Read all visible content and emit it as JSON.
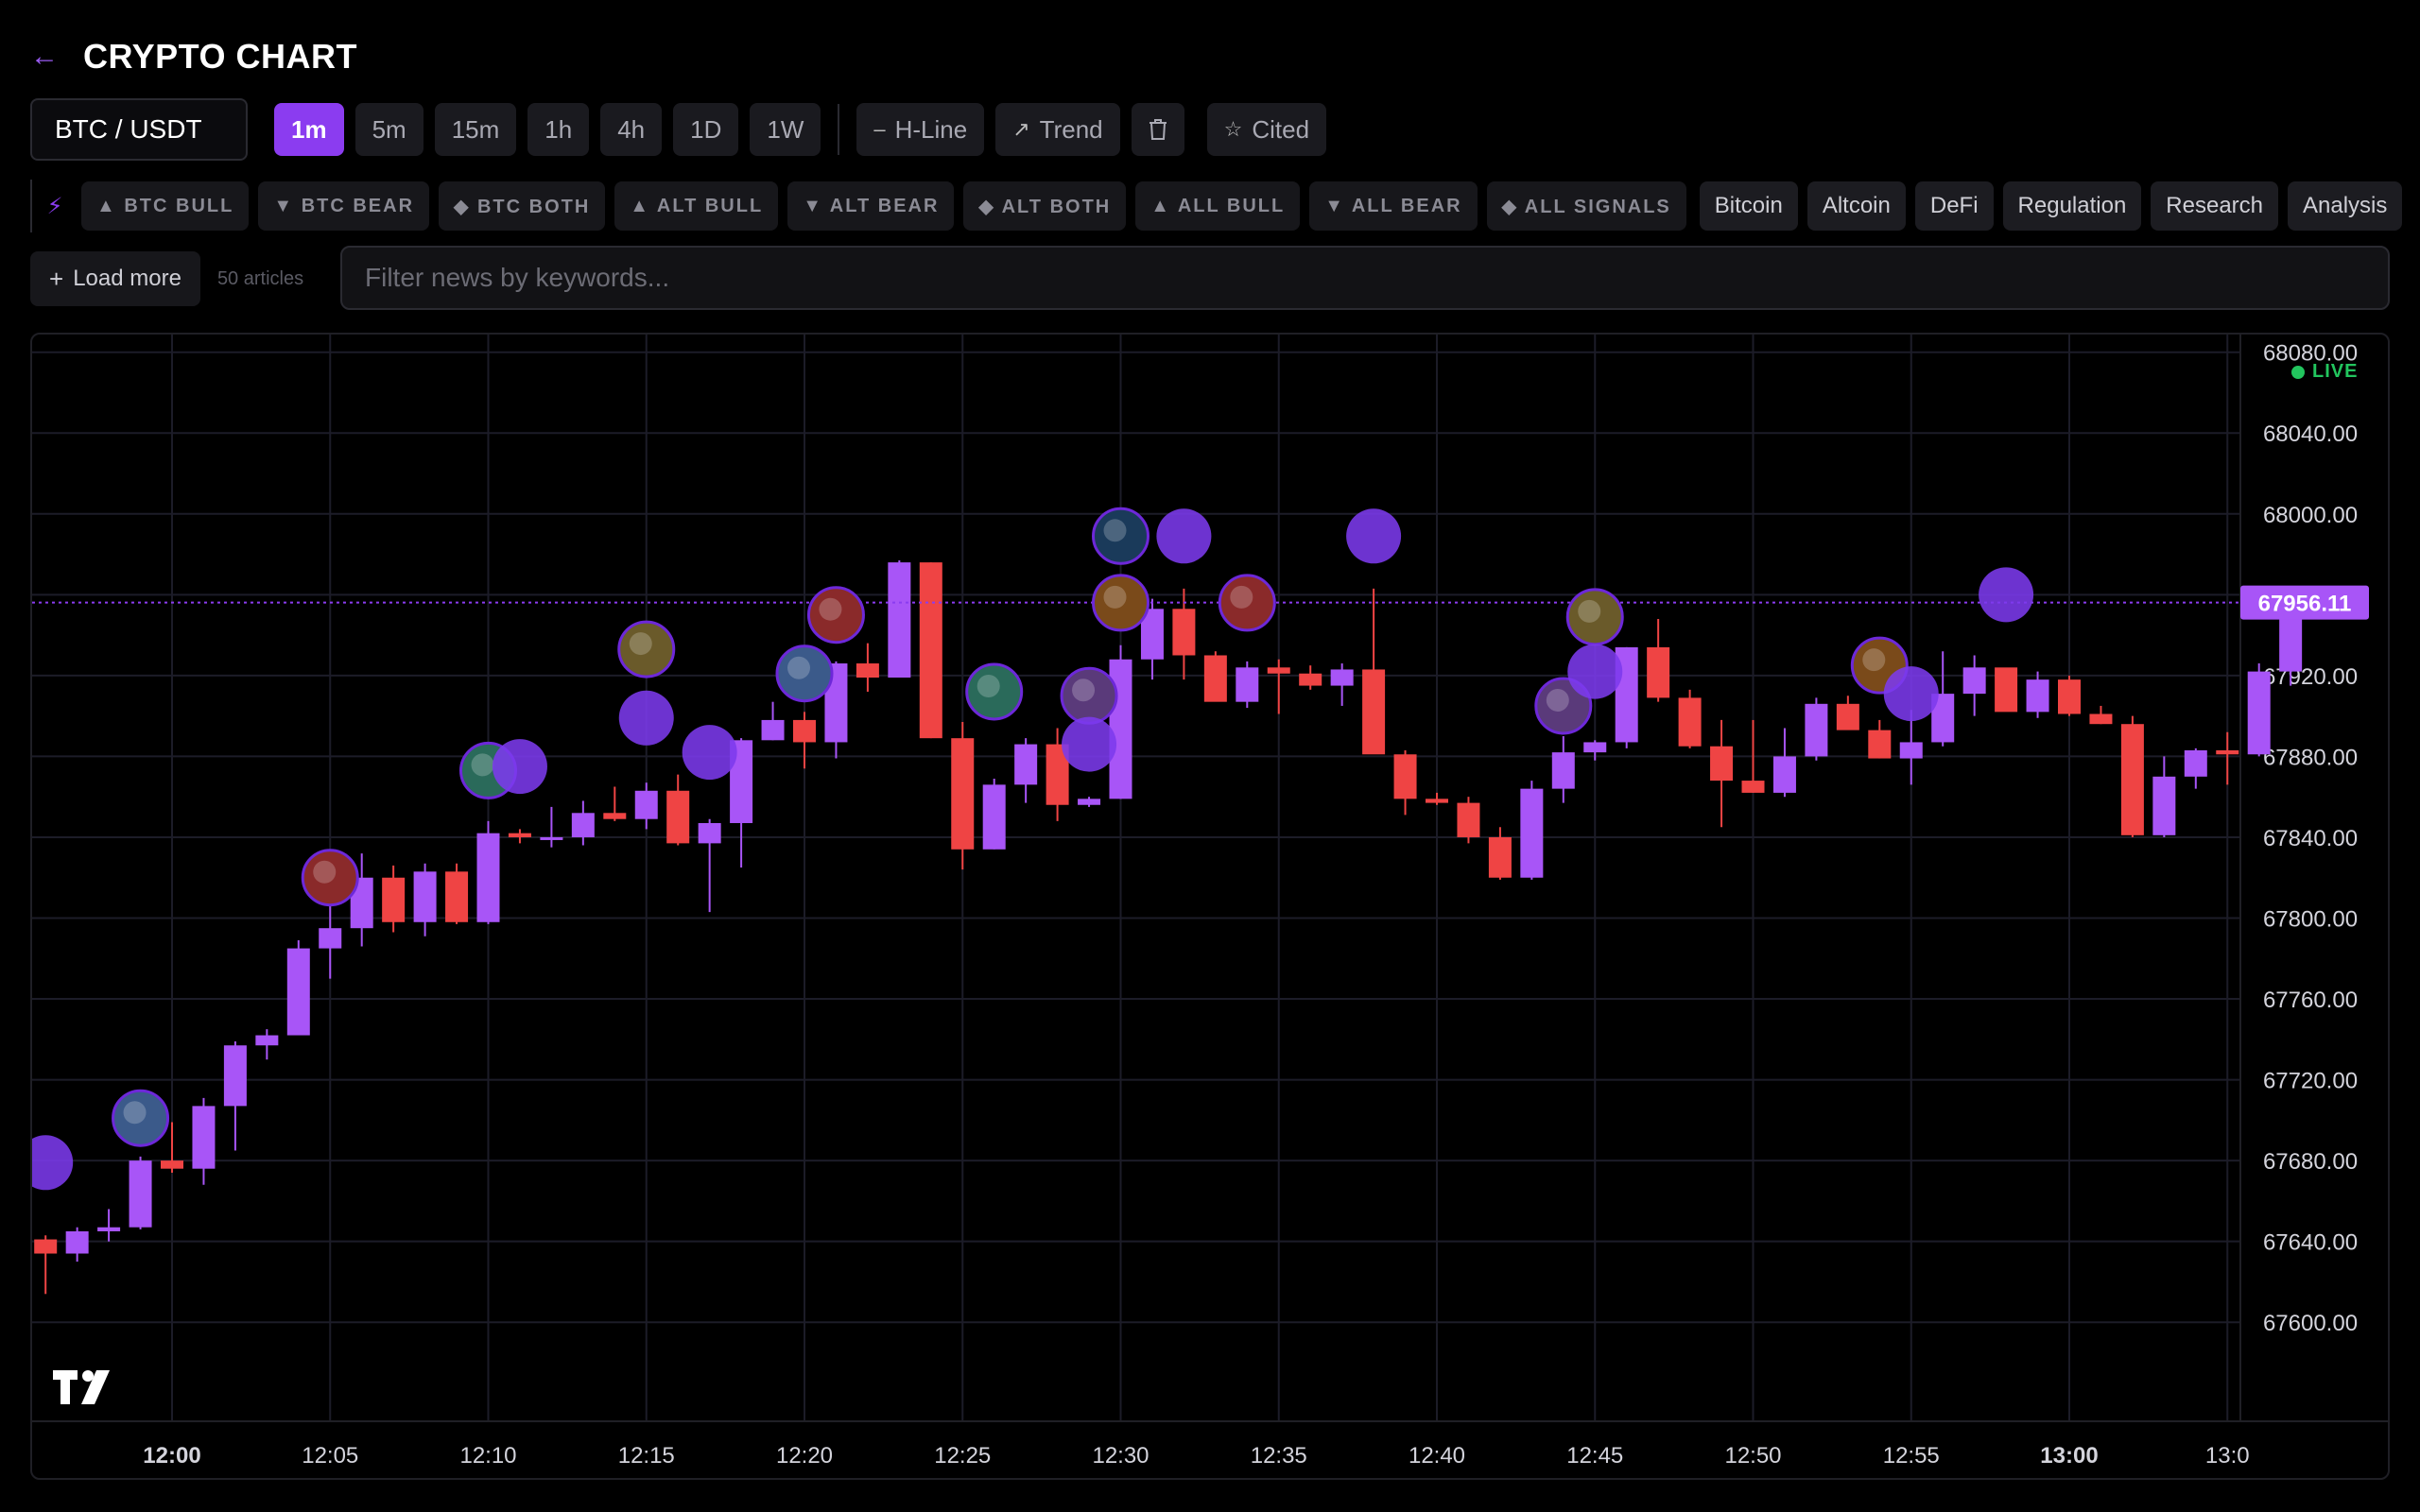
{
  "header": {
    "title": "CRYPTO CHART",
    "back_icon": "arrow-left-icon"
  },
  "toolbar": {
    "symbol": "BTC / USDT",
    "timeframes": [
      "1m",
      "5m",
      "15m",
      "1h",
      "4h",
      "1D",
      "1W"
    ],
    "active_timeframe": "1m",
    "hline_label": "H-Line",
    "trend_label": "Trend",
    "delete_icon": "trash-icon",
    "cited_label": "Cited"
  },
  "filters": {
    "signal_chips": [
      "▲ BTC BULL",
      "▼ BTC BEAR",
      "◆ BTC BOTH",
      "▲ ALT BULL",
      "▼ ALT BEAR",
      "◆ ALT BOTH",
      "▲ ALL BULL",
      "▼ ALL BEAR",
      "◆ ALL SIGNALS"
    ],
    "categories": [
      "Bitcoin",
      "Altcoin",
      "DeFi",
      "Regulation",
      "Research",
      "Analysis"
    ]
  },
  "news": {
    "load_more_label": "Load more",
    "article_count": "50 articles",
    "filter_placeholder": "Filter news by keywords..."
  },
  "chart": {
    "live_label": "LIVE",
    "logo_text": "TV",
    "colors": {
      "up": "#a855f7",
      "down": "#ef4444",
      "accent": "#8b3cf0",
      "grid": "#1c1c28",
      "live": "#22c55e"
    }
  },
  "chart_data": {
    "type": "candlestick",
    "symbol": "BTC / USDT",
    "interval": "1m",
    "current_price": "67956.11",
    "ylim": [
      67580,
      68085
    ],
    "y_ticks": [
      "68080.00",
      "68040.00",
      "68000.00",
      "67960.00",
      "67920.00",
      "67880.00",
      "67840.00",
      "67800.00",
      "67760.00",
      "67720.00",
      "67680.00",
      "67640.00",
      "67600.00"
    ],
    "x_ticks": [
      "12:00",
      "12:05",
      "12:10",
      "12:15",
      "12:20",
      "12:25",
      "12:30",
      "12:35",
      "12:40",
      "12:45",
      "12:50",
      "12:55",
      "13:00",
      "13:0"
    ],
    "x_start_minute_offset": -4.5,
    "candles": [
      [
        67641,
        67643,
        67614,
        67634
      ],
      [
        67634,
        67647,
        67630,
        67645
      ],
      [
        67645,
        67656,
        67640,
        67647
      ],
      [
        67647,
        67682,
        67646,
        67680
      ],
      [
        67680,
        67699,
        67674,
        67676
      ],
      [
        67676,
        67711,
        67668,
        67707
      ],
      [
        67707,
        67739,
        67685,
        67737
      ],
      [
        67737,
        67745,
        67730,
        67742
      ],
      [
        67742,
        67789,
        67742,
        67785
      ],
      [
        67785,
        67808,
        67770,
        67795
      ],
      [
        67795,
        67832,
        67786,
        67820
      ],
      [
        67820,
        67826,
        67793,
        67798
      ],
      [
        67798,
        67827,
        67791,
        67823
      ],
      [
        67823,
        67827,
        67797,
        67798
      ],
      [
        67798,
        67848,
        67797,
        67842
      ],
      [
        67842,
        67844,
        67837,
        67840
      ],
      [
        67840,
        67855,
        67835,
        67840
      ],
      [
        67840,
        67858,
        67836,
        67852
      ],
      [
        67852,
        67865,
        67848,
        67849
      ],
      [
        67849,
        67867,
        67844,
        67863
      ],
      [
        67863,
        67871,
        67836,
        67837
      ],
      [
        67837,
        67849,
        67803,
        67847
      ],
      [
        67847,
        67889,
        67825,
        67888
      ],
      [
        67888,
        67907,
        67888,
        67898
      ],
      [
        67898,
        67902,
        67874,
        67887
      ],
      [
        67887,
        67927,
        67879,
        67926
      ],
      [
        67926,
        67936,
        67912,
        67919
      ],
      [
        67919,
        67977,
        67919,
        67976
      ],
      [
        67976,
        67976,
        67889,
        67889
      ],
      [
        67889,
        67897,
        67824,
        67834
      ],
      [
        67834,
        67869,
        67834,
        67866
      ],
      [
        67866,
        67889,
        67857,
        67886
      ],
      [
        67886,
        67894,
        67848,
        67856
      ],
      [
        67856,
        67860,
        67855,
        67859
      ],
      [
        67859,
        67935,
        67859,
        67928
      ],
      [
        67928,
        67958,
        67918,
        67953
      ],
      [
        67953,
        67963,
        67918,
        67930
      ],
      [
        67930,
        67932,
        67909,
        67907
      ],
      [
        67907,
        67927,
        67904,
        67924
      ],
      [
        67924,
        67928,
        67901,
        67921
      ],
      [
        67921,
        67925,
        67913,
        67915
      ],
      [
        67915,
        67926,
        67905,
        67923
      ],
      [
        67923,
        67963,
        67882,
        67881
      ],
      [
        67881,
        67883,
        67851,
        67859
      ],
      [
        67859,
        67862,
        67856,
        67857
      ],
      [
        67857,
        67860,
        67837,
        67840
      ],
      [
        67840,
        67845,
        67819,
        67820
      ],
      [
        67820,
        67868,
        67819,
        67864
      ],
      [
        67864,
        67890,
        67857,
        67882
      ],
      [
        67882,
        67888,
        67878,
        67887
      ],
      [
        67887,
        67934,
        67884,
        67934
      ],
      [
        67934,
        67948,
        67907,
        67909
      ],
      [
        67909,
        67913,
        67884,
        67885
      ],
      [
        67885,
        67898,
        67845,
        67868
      ],
      [
        67868,
        67898,
        67862,
        67862
      ],
      [
        67862,
        67894,
        67860,
        67880
      ],
      [
        67880,
        67909,
        67878,
        67906
      ],
      [
        67906,
        67910,
        67894,
        67893
      ],
      [
        67893,
        67898,
        67879,
        67879
      ],
      [
        67879,
        67903,
        67866,
        67887
      ],
      [
        67887,
        67932,
        67885,
        67911
      ],
      [
        67911,
        67930,
        67900,
        67924
      ],
      [
        67924,
        67922,
        67903,
        67902
      ],
      [
        67902,
        67922,
        67899,
        67918
      ],
      [
        67918,
        67920,
        67900,
        67901
      ],
      [
        67901,
        67905,
        67896,
        67896
      ],
      [
        67896,
        67900,
        67840,
        67841
      ],
      [
        67841,
        67880,
        67840,
        67870
      ],
      [
        67870,
        67884,
        67864,
        67883
      ],
      [
        67883,
        67892,
        67866,
        67881
      ],
      [
        67881,
        67926,
        67880,
        67922
      ],
      [
        67922,
        67955,
        67915,
        67956
      ]
    ],
    "news_markers": [
      {
        "minute": -4.0,
        "price": 67679,
        "kind": "solid"
      },
      {
        "minute": -1.0,
        "price": 67701,
        "kind": "image"
      },
      {
        "minute": 5.0,
        "price": 67820,
        "kind": "image"
      },
      {
        "minute": 10.0,
        "price": 67873,
        "kind": "image"
      },
      {
        "minute": 11.0,
        "price": 67875,
        "kind": "solid"
      },
      {
        "minute": 15.0,
        "price": 67933,
        "kind": "image"
      },
      {
        "minute": 15.0,
        "price": 67899,
        "kind": "solid"
      },
      {
        "minute": 17.0,
        "price": 67882,
        "kind": "solid"
      },
      {
        "minute": 20.0,
        "price": 67921,
        "kind": "image"
      },
      {
        "minute": 21.0,
        "price": 67950,
        "kind": "image"
      },
      {
        "minute": 26.0,
        "price": 67912,
        "kind": "image"
      },
      {
        "minute": 29.0,
        "price": 67910,
        "kind": "image"
      },
      {
        "minute": 29.0,
        "price": 67886,
        "kind": "solid"
      },
      {
        "minute": 30.0,
        "price": 67989,
        "kind": "image"
      },
      {
        "minute": 30.0,
        "price": 67956,
        "kind": "image"
      },
      {
        "minute": 32.0,
        "price": 67989,
        "kind": "solid"
      },
      {
        "minute": 34.0,
        "price": 67956,
        "kind": "image"
      },
      {
        "minute": 38.0,
        "price": 67989,
        "kind": "solid"
      },
      {
        "minute": 44.0,
        "price": 67905,
        "kind": "image"
      },
      {
        "minute": 45.0,
        "price": 67949,
        "kind": "image"
      },
      {
        "minute": 45.0,
        "price": 67922,
        "kind": "solid"
      },
      {
        "minute": 54.0,
        "price": 67925,
        "kind": "image"
      },
      {
        "minute": 55.0,
        "price": 67911,
        "kind": "solid"
      },
      {
        "minute": 58.0,
        "price": 67960,
        "kind": "solid"
      }
    ]
  }
}
